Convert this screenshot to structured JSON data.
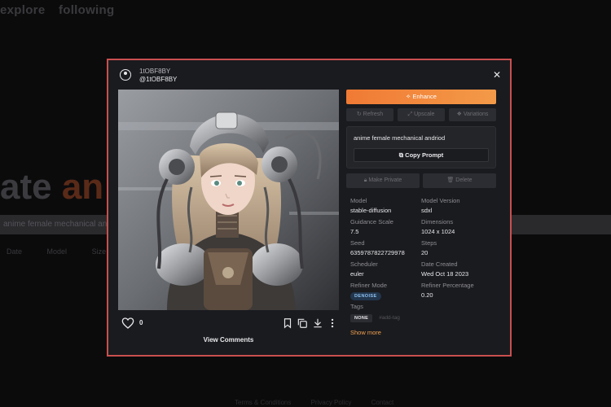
{
  "background": {
    "nav": [
      "explore",
      "following"
    ],
    "hero_plain": "ate ",
    "hero_accent": "an",
    "search_value": "anime female mechanical andriod",
    "filter_labels": [
      "Date",
      "Model",
      "Size"
    ],
    "footer_links": [
      "Terms & Conditions",
      "Privacy Policy",
      "Contact"
    ]
  },
  "modal": {
    "user": {
      "name": "1tOBF8BY",
      "handle": "@1tOBF8BY"
    },
    "image_alt": "anime female mechanical andriod",
    "likes": "0",
    "view_comments_label": "View Comments",
    "enhance_label": "Enhance",
    "action_buttons": [
      "Refresh",
      "Upscale",
      "Variations"
    ],
    "prompt": "anime female mechanical andriod",
    "copy_prompt_label": "Copy Prompt",
    "secondary_buttons": [
      "Make Private",
      "Delete"
    ],
    "details": {
      "model_label": "Model",
      "model_value": "stable-diffusion",
      "model_version_label": "Model Version",
      "model_version_value": "sdxl",
      "guidance_label": "Guidance Scale",
      "guidance_value": "7.5",
      "dimensions_label": "Dimensions",
      "dimensions_value": "1024 x 1024",
      "seed_label": "Seed",
      "seed_value": "6359787822729978",
      "steps_label": "Steps",
      "steps_value": "20",
      "scheduler_label": "Scheduler",
      "scheduler_value": "euler",
      "date_label": "Date Created",
      "date_value": "Wed Oct 18 2023",
      "refiner_mode_label": "Refiner Mode",
      "refiner_mode_value": "DENOISE",
      "refiner_pct_label": "Refiner Percentage",
      "refiner_pct_value": "0.20",
      "tags_label": "Tags",
      "tag_none": "NONE",
      "tag_add": "#add-tag"
    },
    "show_more_label": "Show more"
  },
  "colors": {
    "accent": "#f07a34",
    "modal_border": "#c9504f",
    "modal_bg": "#1a1b1f",
    "link": "#f0a050",
    "badge_bg": "#22364d"
  },
  "icons": [
    "user-circle-icon",
    "close-icon",
    "sparkle-icon",
    "refresh-icon",
    "copy-icon",
    "heart-icon",
    "bookmark-icon",
    "duplicate-icon",
    "download-icon",
    "more-vertical-icon",
    "lock-icon",
    "trash-icon"
  ]
}
